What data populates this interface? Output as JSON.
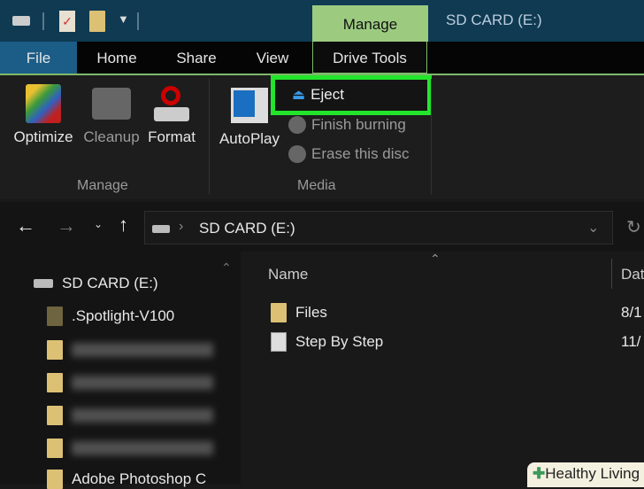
{
  "titlebar": {
    "title": "SD CARD (E:)",
    "context_tab": "Manage"
  },
  "tabs": [
    "File",
    "Home",
    "Share",
    "View",
    "Drive Tools"
  ],
  "ribbon": {
    "manage_group": {
      "label": "Manage",
      "buttons": [
        "Optimize",
        "Cleanup",
        "Format"
      ]
    },
    "media_group": {
      "label": "Media",
      "autoplay": "AutoPlay",
      "eject": "Eject",
      "finish_burning": "Finish burning",
      "erase": "Erase this disc"
    }
  },
  "address": {
    "path": "SD CARD (E:)"
  },
  "nav": {
    "root": "SD CARD (E:)",
    "items": [
      ".Spotlight-V100",
      "Adobe Photoshop C"
    ]
  },
  "content": {
    "columns": [
      "Name",
      "Dat"
    ],
    "rows": [
      {
        "name": "Files",
        "date": "8/1"
      },
      {
        "name": "Step By Step",
        "date": "11/"
      }
    ]
  },
  "watermark": "Healthy Living",
  "colors": {
    "highlight": "#22e52b",
    "manage_tab": "#9ccb80",
    "file_tab": "#1c5d87"
  }
}
